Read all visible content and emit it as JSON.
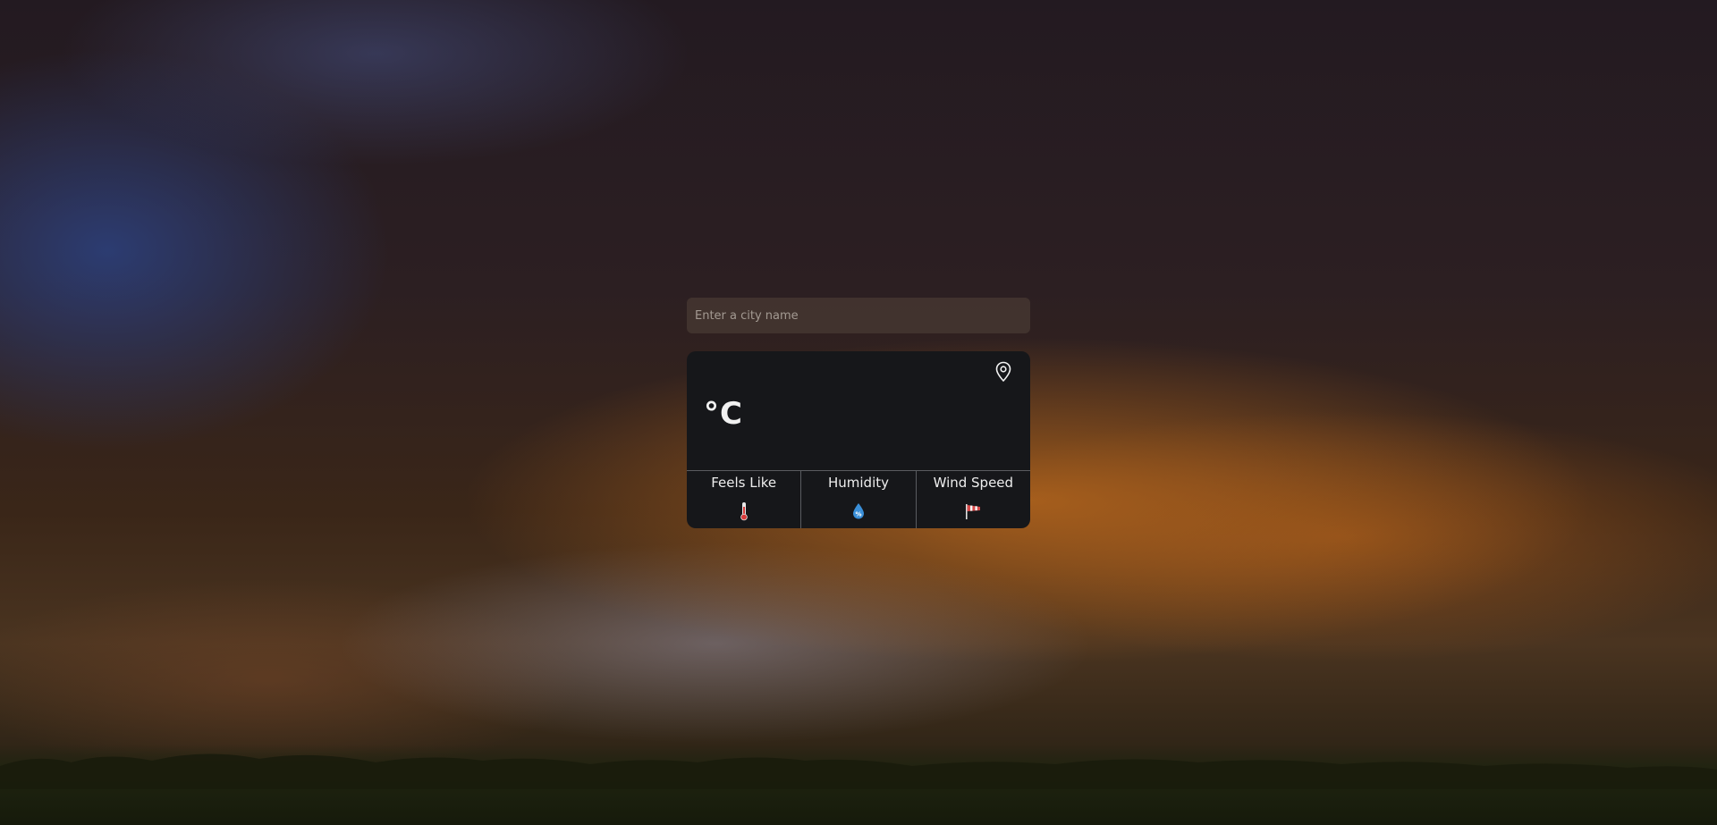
{
  "search": {
    "placeholder": "Enter a city name",
    "value": ""
  },
  "weather_card": {
    "temperature_unit": "°C",
    "location_icon": "location-pin-icon",
    "stats": [
      {
        "label": "Feels Like",
        "icon": "thermometer-icon"
      },
      {
        "label": "Humidity",
        "icon": "water-drop-percent-icon"
      },
      {
        "label": "Wind Speed",
        "icon": "windsock-icon"
      }
    ]
  },
  "colors": {
    "card_background": "#16171a",
    "search_background": "#46383280",
    "divider": "#5a5c60",
    "thermometer_red": "#d83a3a",
    "humidity_blue": "#3a8fd8",
    "windsock_red": "#d84a4a"
  }
}
